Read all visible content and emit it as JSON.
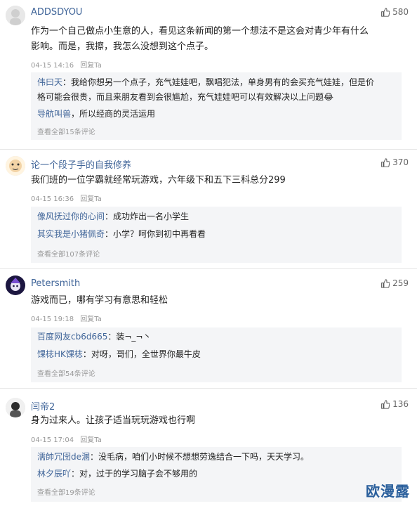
{
  "comments": [
    {
      "username": "ADDSDYOU",
      "likes": "580",
      "text": [
        "作为一个自己做点小生意的人，看见这条新闻的第一个想法不是这会对青少年有什么",
        "影响。而是，我擦，我怎么没想到这个点子。"
      ],
      "time": "04-15 14:16",
      "reply": "回复Ta",
      "replies": [
        {
          "name": "伟曰天",
          "text_lines": [
            "：我给你想另一个点子，充气娃娃吧，飘唱犯法，单身男有的会买充气娃娃，但是价",
            "格可能会很贵，而且来朋友看到会很尴尬，充气娃娃吧可以有效解决以上问题😂"
          ]
        },
        {
          "name": "导航叫兽",
          "text_lines": [
            "，所以经商的灵活运用"
          ]
        }
      ],
      "view_all": "查看全部15条评论"
    },
    {
      "username": "论一个段子手的自我修养",
      "likes": "370",
      "text": [
        "我们班的一位学霸就经常玩游戏，六年级下和五下三科总分299"
      ],
      "time": "04-15 16:36",
      "reply": "回复Ta",
      "replies": [
        {
          "name": "像风抚过你的心间",
          "text_lines": [
            "：成功炸出一名小学生"
          ]
        },
        {
          "name": "其实我是小猪佩奇",
          "text_lines": [
            "：小学？呵你到初中再看看"
          ]
        }
      ],
      "view_all": "查看全部107条评论"
    },
    {
      "username": "Petersmith",
      "likes": "259",
      "text": [
        "游戏而已，哪有学习有意思和轻松"
      ],
      "time": "04-15 19:18",
      "reply": "回复Ta",
      "replies": [
        {
          "name": "百度网友cb6d665",
          "text_lines": [
            "：装¬_¬丶"
          ]
        },
        {
          "name": "馃梽HK馃梽",
          "text_lines": [
            "：对呀，哥们，全世界你最牛皮"
          ]
        }
      ],
      "view_all": "查看全部54条评论"
    },
    {
      "username": "闫帝2",
      "likes": "136",
      "text": [
        "身为过来人。让孩子适当玩玩游戏也行啊"
      ],
      "time": "04-15 17:04",
      "reply": "回复Ta",
      "replies": [
        {
          "name": "濡帥冗囹de溷",
          "text_lines": [
            "：没毛病，咱们小时候不想想劳逸结合一下吗，天天学习。"
          ]
        },
        {
          "name": "林夕辰吖",
          "text_lines": [
            "：对，过于的学习脑子会不够用的"
          ]
        }
      ],
      "view_all": "查看全部19条评论"
    }
  ],
  "watermark": "欧漫露",
  "colors": {
    "username": "#406599",
    "meta": "#999999",
    "reply_bg": "#f4f5f7",
    "watermark": "#2a5f9c"
  },
  "icons": {
    "like": "thumbs-up-icon"
  }
}
